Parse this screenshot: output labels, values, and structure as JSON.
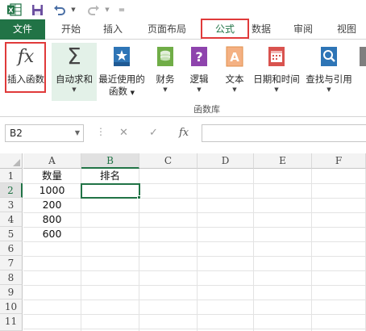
{
  "colors": {
    "accent": "#217346",
    "highlight": "#e03a3a"
  },
  "qat": {
    "icons": [
      "excel-logo-icon",
      "save-icon",
      "undo-icon",
      "redo-icon",
      "customize-icon"
    ],
    "customize_glyph": "="
  },
  "tabs": [
    {
      "label": "文件"
    },
    {
      "label": "开始"
    },
    {
      "label": "插入"
    },
    {
      "label": "页面布局"
    },
    {
      "label": "公式"
    },
    {
      "label": "数据"
    },
    {
      "label": "审阅"
    },
    {
      "label": "视图"
    }
  ],
  "active_tab": "公式",
  "ribbon": {
    "insert_function": {
      "glyph": "fx",
      "label": "插入函数"
    },
    "autosum": {
      "glyph": "Σ",
      "label": "自动求和"
    },
    "recently_used": {
      "line1": "最近使用的",
      "line2": "函数"
    },
    "financial": {
      "label": "财务"
    },
    "logical": {
      "label": "逻辑"
    },
    "text": {
      "label": "文本"
    },
    "datetime": {
      "label": "日期和时间"
    },
    "lookup": {
      "label": "查找与引用"
    },
    "group_label": "函数库"
  },
  "formula_bar": {
    "name_box": "B2",
    "cancel_glyph": "✕",
    "enter_glyph": "✓",
    "fx_glyph": "fx",
    "value": ""
  },
  "sheet": {
    "columns": [
      "A",
      "B",
      "C",
      "D",
      "E",
      "F"
    ],
    "rows": [
      "1",
      "2",
      "3",
      "4",
      "5",
      "6",
      "7",
      "8",
      "9",
      "10",
      "11"
    ],
    "selected_cell": "B2",
    "cells": {
      "A1": "数量",
      "B1": "排名",
      "A2": "1000",
      "A3": "200",
      "A4": "800",
      "A5": "600"
    }
  }
}
